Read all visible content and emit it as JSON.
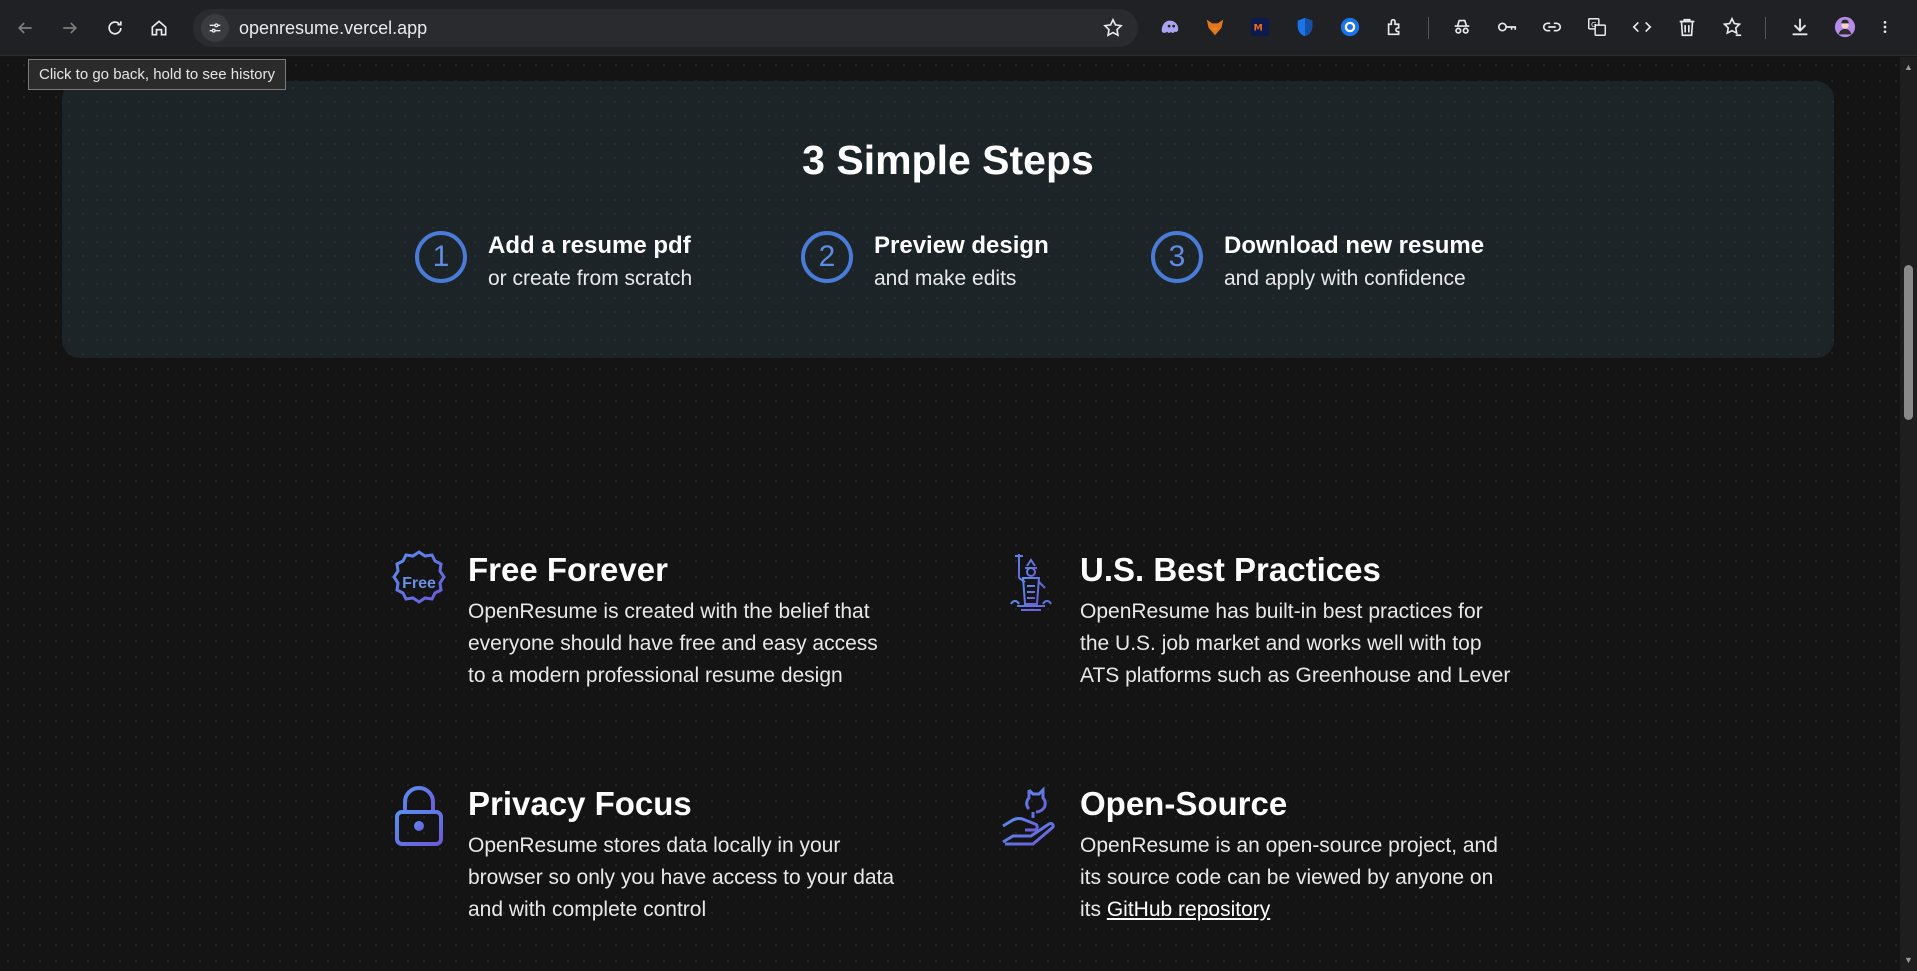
{
  "browser": {
    "url": "openresume.vercel.app",
    "tooltip": "Click to go back, hold to see history",
    "nav": [
      "back-icon",
      "forward-icon",
      "reload-icon",
      "home-icon"
    ],
    "extensions": [
      "ghost-icon",
      "fox-icon",
      "metamask-icon",
      "shield-icon",
      "circle-icon",
      "puzzle-icon",
      "spy-icon",
      "key-icon",
      "link-icon",
      "translate-icon",
      "code-icon",
      "trash-icon",
      "bookmark-star-icon",
      "download-icon",
      "avatar",
      "menu-icon"
    ]
  },
  "steps": {
    "title": "3 Simple Steps",
    "items": [
      {
        "num": "1",
        "title": "Add a resume pdf",
        "sub": "or create from scratch"
      },
      {
        "num": "2",
        "title": "Preview design",
        "sub": "and make edits"
      },
      {
        "num": "3",
        "title": "Download new resume",
        "sub": "and apply with confidence"
      }
    ]
  },
  "features": [
    {
      "title": "Free Forever",
      "icon": "free-badge-icon",
      "badge_text": "Free",
      "lines": [
        "OpenResume is created with the belief that",
        "everyone should have free and easy access",
        "to a modern professional resume design"
      ]
    },
    {
      "title": "U.S. Best Practices",
      "icon": "statue-of-liberty-icon",
      "lines": [
        "OpenResume has built-in best practices for",
        "the U.S. job market and works well with top",
        "ATS platforms such as Greenhouse and Lever"
      ]
    },
    {
      "title": "Privacy Focus",
      "icon": "lock-icon",
      "lines": [
        "OpenResume stores data locally in your",
        "browser so only you have access to your data",
        "and with complete control"
      ]
    },
    {
      "title": "Open-Source",
      "icon": "github-hand-icon",
      "lines": [
        "OpenResume is an open-source project, and",
        "its source code can be viewed by anyone on"
      ],
      "last_prefix": "its ",
      "link": "GitHub repository"
    }
  ],
  "colors": {
    "accent": "#4a7bd6",
    "card": "#1c2428",
    "background": "#141414"
  }
}
